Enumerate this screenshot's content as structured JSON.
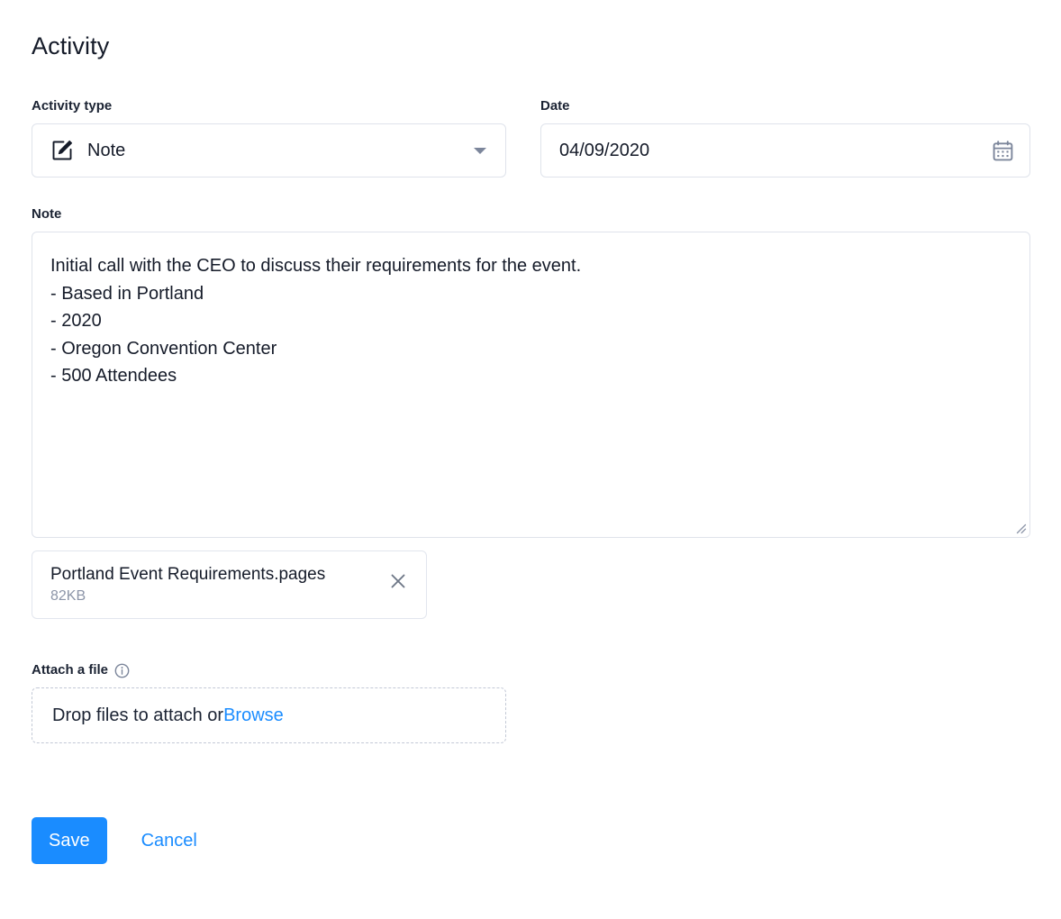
{
  "page": {
    "title": "Activity"
  },
  "activity_type": {
    "label": "Activity type",
    "value": "Note",
    "icon": "compose-note-icon",
    "caret_icon": "chevron-down-icon"
  },
  "date": {
    "label": "Date",
    "value": "04/09/2020",
    "placeholder": "MM/DD/YYYY",
    "icon": "calendar-icon"
  },
  "note": {
    "label": "Note",
    "value": "Initial call with the CEO to discuss their requirements for the event.\n- Based in Portland\n- 2020\n- Oregon Convention Center\n- 500 Attendees",
    "placeholder": "Add a note"
  },
  "attached_files": [
    {
      "name": "Portland Event Requirements.pages",
      "size": "82KB",
      "remove_icon": "close-icon"
    }
  ],
  "attach": {
    "label": "Attach a file",
    "info_icon": "info-icon",
    "dropzone_text": "Drop files to attach or ",
    "browse_label": "Browse"
  },
  "actions": {
    "save_label": "Save",
    "cancel_label": "Cancel"
  },
  "colors": {
    "accent": "#1a8cff",
    "text": "#151b29",
    "muted": "#8c95a8",
    "border": "#dfe3eb",
    "dashed_border": "#c3c9d6"
  }
}
